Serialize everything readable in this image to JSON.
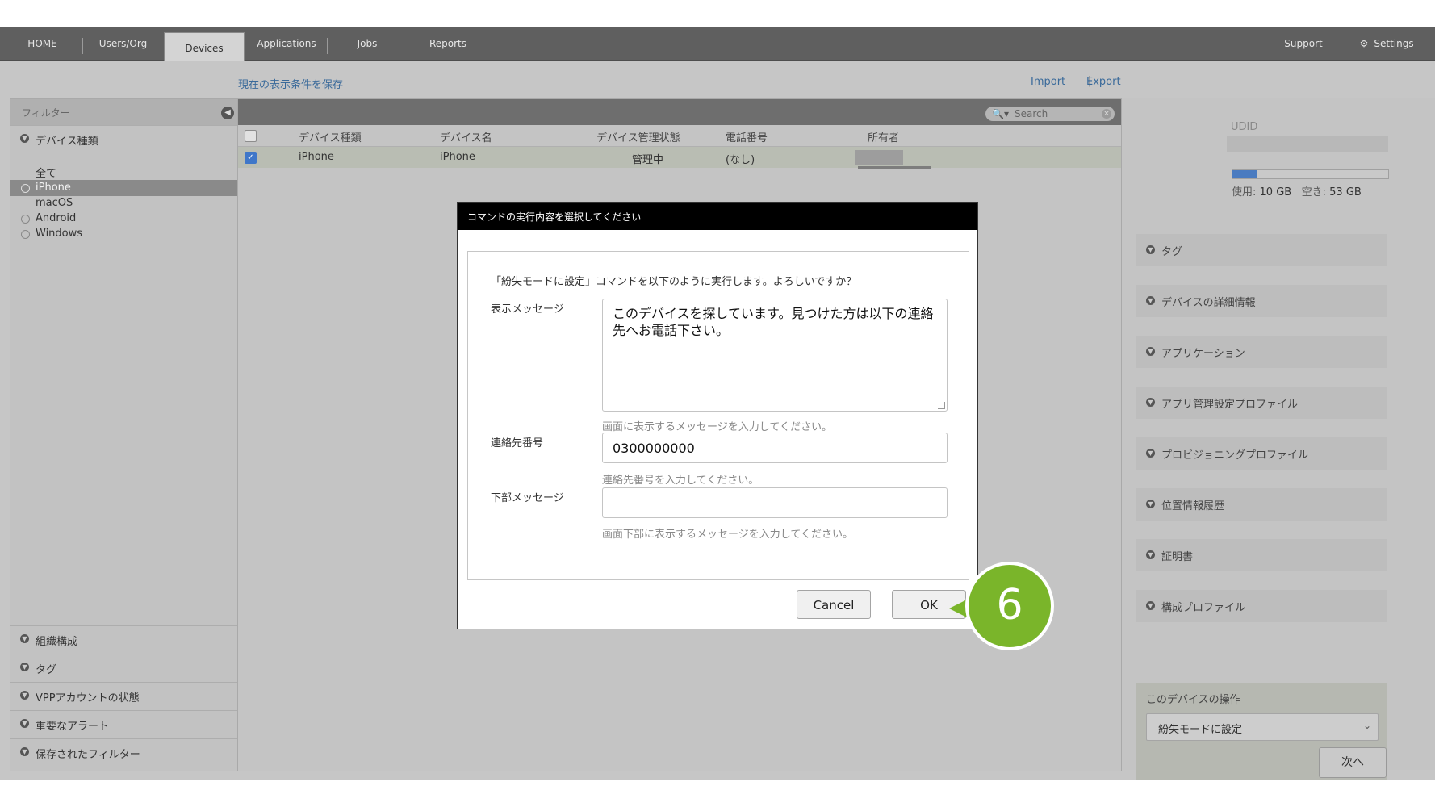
{
  "nav": {
    "tabs": [
      "HOME",
      "Users/Org",
      "Devices",
      "Applications",
      "Jobs",
      "Reports"
    ],
    "active": "Devices",
    "support": "Support",
    "settings": "Settings"
  },
  "links": {
    "save_view": "現在の表示条件を保存",
    "import": "Import",
    "export": "Export",
    "separator": "|"
  },
  "filter": {
    "title": "フィルター",
    "device_type_header": "デバイス種類",
    "device_types": [
      "全て",
      "iPhone",
      "macOS",
      "Android",
      "Windows"
    ],
    "selected_device_type": "iPhone",
    "bottom_sections": [
      "組織構成",
      "タグ",
      "VPPアカウントの状態",
      "重要なアラート",
      "保存されたフィルター"
    ]
  },
  "table": {
    "search_placeholder": "Search",
    "columns": [
      "デバイス種類",
      "デバイス名",
      "デバイス管理状態",
      "電話番号",
      "所有者"
    ],
    "rows": [
      {
        "type": "iPhone",
        "name": "iPhone",
        "status": "管理中",
        "phone": "(なし)",
        "checked": true
      }
    ]
  },
  "right_panel": {
    "udid_label": "UDID",
    "storage": {
      "used_label": "使用:",
      "used": "10 GB",
      "free_label": "空き:",
      "free": "53 GB",
      "used_fraction": 0.16
    },
    "sections": [
      "タグ",
      "デバイスの詳細情報",
      "アプリケーション",
      "アプリ管理設定プロファイル",
      "プロビジョニングプロファイル",
      "位置情報履歴",
      "証明書",
      "構成プロファイル"
    ],
    "operations": {
      "title": "このデバイスの操作",
      "selected": "紛失モードに設定",
      "next_button": "次へ"
    }
  },
  "modal": {
    "title": "コマンドの実行内容を選択してください",
    "confirm_text": "「紛失モードに設定」コマンドを以下のように実行します。よろしいですか？",
    "fields": {
      "display_message": {
        "label": "表示メッセージ",
        "value": "このデバイスを探しています。見つけた方は以下の連絡先へお電話下さい。",
        "hint": "画面に表示するメッセージを入力してください。"
      },
      "contact_number": {
        "label": "連絡先番号",
        "value": "0300000000",
        "hint": "連絡先番号を入力してください。"
      },
      "footer_message": {
        "label": "下部メッセージ",
        "value": "",
        "hint": "画面下部に表示するメッセージを入力してください。"
      }
    },
    "cancel_button": "Cancel",
    "ok_button": "OK"
  },
  "step_badge": "6",
  "colors": {
    "accent": "#3f77c9",
    "badge": "#7ab52a",
    "link": "#3a6a9a"
  }
}
